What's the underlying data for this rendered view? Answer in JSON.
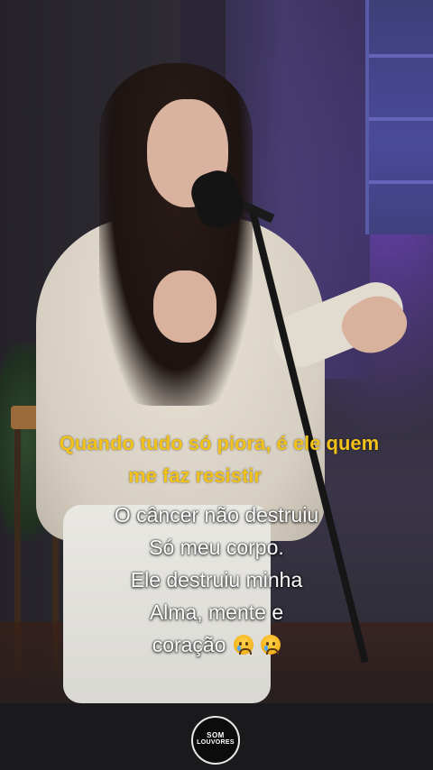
{
  "lyric_caption": {
    "line1": "Quando tudo só piora, é ele quem",
    "line2": "me faz resistir",
    "color": "#f2c21a"
  },
  "message_caption": {
    "lines": [
      "O câncer não destruiu",
      "Só meu corpo.",
      "Ele destruiu minha",
      "Alma, mente e",
      "coração"
    ],
    "emoji": [
      "crying-face",
      "crying-face"
    ]
  },
  "watermark": {
    "line1": "SOM",
    "line2": "LOUVORES"
  }
}
